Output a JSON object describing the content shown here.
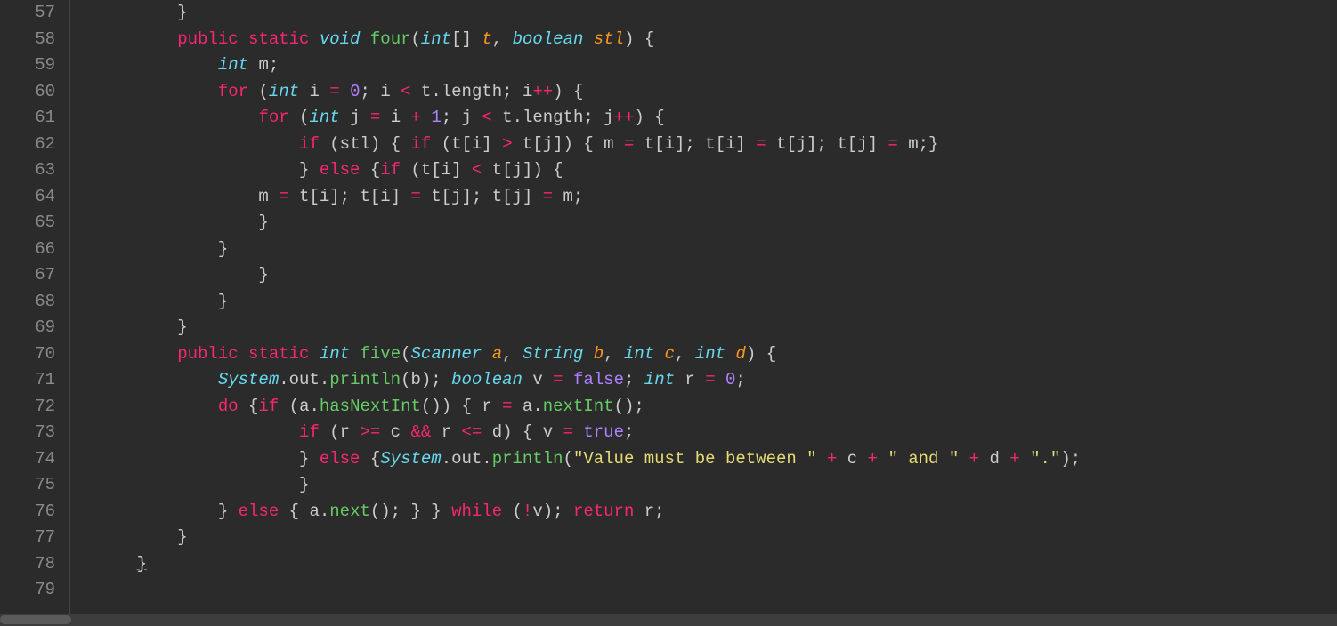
{
  "gutter": {
    "start": 57,
    "end": 79
  },
  "code": {
    "lines": [
      [
        [
          "        }",
          "punct"
        ]
      ],
      [
        [
          "        ",
          "punct"
        ],
        [
          "public",
          "kw"
        ],
        [
          " ",
          "punct"
        ],
        [
          "static",
          "kw"
        ],
        [
          " ",
          "punct"
        ],
        [
          "void",
          "type"
        ],
        [
          " ",
          "punct"
        ],
        [
          "four",
          "fn"
        ],
        [
          "(",
          "punct"
        ],
        [
          "int",
          "type"
        ],
        [
          "[] ",
          "punct"
        ],
        [
          "t",
          "param"
        ],
        [
          ", ",
          "punct"
        ],
        [
          "boolean",
          "type"
        ],
        [
          " ",
          "punct"
        ],
        [
          "stl",
          "param"
        ],
        [
          ") {",
          "punct"
        ]
      ],
      [
        [
          "            ",
          "punct"
        ],
        [
          "int",
          "type"
        ],
        [
          " m;",
          "punct"
        ]
      ],
      [
        [
          "            ",
          "punct"
        ],
        [
          "for",
          "kw"
        ],
        [
          " (",
          "punct"
        ],
        [
          "int",
          "type"
        ],
        [
          " i ",
          "punct"
        ],
        [
          "=",
          "op"
        ],
        [
          " ",
          "punct"
        ],
        [
          "0",
          "num"
        ],
        [
          "; i ",
          "punct"
        ],
        [
          "<",
          "op"
        ],
        [
          " t.length; i",
          "punct"
        ],
        [
          "++",
          "op"
        ],
        [
          ") {",
          "punct"
        ]
      ],
      [
        [
          "                ",
          "punct"
        ],
        [
          "for",
          "kw"
        ],
        [
          " (",
          "punct"
        ],
        [
          "int",
          "type"
        ],
        [
          " j ",
          "punct"
        ],
        [
          "=",
          "op"
        ],
        [
          " i ",
          "punct"
        ],
        [
          "+",
          "op"
        ],
        [
          " ",
          "punct"
        ],
        [
          "1",
          "num"
        ],
        [
          "; j ",
          "punct"
        ],
        [
          "<",
          "op"
        ],
        [
          " t.length; j",
          "punct"
        ],
        [
          "++",
          "op"
        ],
        [
          ") {",
          "punct"
        ]
      ],
      [
        [
          "                    ",
          "punct"
        ],
        [
          "if",
          "kw"
        ],
        [
          " (stl) { ",
          "punct"
        ],
        [
          "if",
          "kw"
        ],
        [
          " (t[i] ",
          "punct"
        ],
        [
          ">",
          "op"
        ],
        [
          " t[j]) { m ",
          "punct"
        ],
        [
          "=",
          "op"
        ],
        [
          " t[i]; t[i] ",
          "punct"
        ],
        [
          "=",
          "op"
        ],
        [
          " t[j]; t[j] ",
          "punct"
        ],
        [
          "=",
          "op"
        ],
        [
          " m;}",
          "punct"
        ]
      ],
      [
        [
          "                    } ",
          "punct"
        ],
        [
          "else",
          "kw"
        ],
        [
          " {",
          "punct"
        ],
        [
          "if",
          "kw"
        ],
        [
          " (t[i] ",
          "punct"
        ],
        [
          "<",
          "op"
        ],
        [
          " t[j]) {",
          "punct"
        ]
      ],
      [
        [
          "                m ",
          "punct"
        ],
        [
          "=",
          "op"
        ],
        [
          " t[i]; t[i] ",
          "punct"
        ],
        [
          "=",
          "op"
        ],
        [
          " t[j]; t[j] ",
          "punct"
        ],
        [
          "=",
          "op"
        ],
        [
          " m;",
          "punct"
        ]
      ],
      [
        [
          "                }",
          "punct"
        ]
      ],
      [
        [
          "            }",
          "punct"
        ]
      ],
      [
        [
          "                }",
          "punct"
        ]
      ],
      [
        [
          "            }",
          "punct"
        ]
      ],
      [
        [
          "        }",
          "punct"
        ]
      ],
      [
        [
          "        ",
          "punct"
        ],
        [
          "public",
          "kw"
        ],
        [
          " ",
          "punct"
        ],
        [
          "static",
          "kw"
        ],
        [
          " ",
          "punct"
        ],
        [
          "int",
          "type"
        ],
        [
          " ",
          "punct"
        ],
        [
          "five",
          "fn"
        ],
        [
          "(",
          "punct"
        ],
        [
          "Scanner",
          "type"
        ],
        [
          " ",
          "punct"
        ],
        [
          "a",
          "param"
        ],
        [
          ", ",
          "punct"
        ],
        [
          "String",
          "type"
        ],
        [
          " ",
          "punct"
        ],
        [
          "b",
          "param"
        ],
        [
          ", ",
          "punct"
        ],
        [
          "int",
          "type"
        ],
        [
          " ",
          "punct"
        ],
        [
          "c",
          "param"
        ],
        [
          ", ",
          "punct"
        ],
        [
          "int",
          "type"
        ],
        [
          " ",
          "punct"
        ],
        [
          "d",
          "param"
        ],
        [
          ") {",
          "punct"
        ]
      ],
      [
        [
          "            ",
          "punct"
        ],
        [
          "System",
          "type"
        ],
        [
          ".out.",
          "punct"
        ],
        [
          "println",
          "fn"
        ],
        [
          "(b); ",
          "punct"
        ],
        [
          "boolean",
          "type"
        ],
        [
          " v ",
          "punct"
        ],
        [
          "=",
          "op"
        ],
        [
          " ",
          "punct"
        ],
        [
          "false",
          "const"
        ],
        [
          "; ",
          "punct"
        ],
        [
          "int",
          "type"
        ],
        [
          " r ",
          "punct"
        ],
        [
          "=",
          "op"
        ],
        [
          " ",
          "punct"
        ],
        [
          "0",
          "num"
        ],
        [
          ";",
          "punct"
        ]
      ],
      [
        [
          "            ",
          "punct"
        ],
        [
          "do",
          "kw"
        ],
        [
          " {",
          "punct"
        ],
        [
          "if",
          "kw"
        ],
        [
          " (a.",
          "punct"
        ],
        [
          "hasNextInt",
          "fn"
        ],
        [
          "()) { r ",
          "punct"
        ],
        [
          "=",
          "op"
        ],
        [
          " a.",
          "punct"
        ],
        [
          "nextInt",
          "fn"
        ],
        [
          "();",
          "punct"
        ]
      ],
      [
        [
          "                    ",
          "punct"
        ],
        [
          "if",
          "kw"
        ],
        [
          " (r ",
          "punct"
        ],
        [
          ">=",
          "op"
        ],
        [
          " c ",
          "punct"
        ],
        [
          "&&",
          "op"
        ],
        [
          " r ",
          "punct"
        ],
        [
          "<=",
          "op"
        ],
        [
          " d) { v ",
          "punct"
        ],
        [
          "=",
          "op"
        ],
        [
          " ",
          "punct"
        ],
        [
          "true",
          "const"
        ],
        [
          ";",
          "punct"
        ]
      ],
      [
        [
          "                    } ",
          "punct"
        ],
        [
          "else",
          "kw"
        ],
        [
          " {",
          "punct"
        ],
        [
          "System",
          "type"
        ],
        [
          ".out.",
          "punct"
        ],
        [
          "println",
          "fn"
        ],
        [
          "(",
          "punct"
        ],
        [
          "\"Value must be between \"",
          "str"
        ],
        [
          " ",
          "punct"
        ],
        [
          "+",
          "op"
        ],
        [
          " c ",
          "punct"
        ],
        [
          "+",
          "op"
        ],
        [
          " ",
          "punct"
        ],
        [
          "\" and \"",
          "str"
        ],
        [
          " ",
          "punct"
        ],
        [
          "+",
          "op"
        ],
        [
          " d ",
          "punct"
        ],
        [
          "+",
          "op"
        ],
        [
          " ",
          "punct"
        ],
        [
          "\".\"",
          "str"
        ],
        [
          ");",
          "punct"
        ]
      ],
      [
        [
          "                    }",
          "punct"
        ]
      ],
      [
        [
          "            } ",
          "punct"
        ],
        [
          "else",
          "kw"
        ],
        [
          " { a.",
          "punct"
        ],
        [
          "next",
          "fn"
        ],
        [
          "(); } } ",
          "punct"
        ],
        [
          "while",
          "kw"
        ],
        [
          " (",
          "punct"
        ],
        [
          "!",
          "op"
        ],
        [
          "v); ",
          "punct"
        ],
        [
          "return",
          "kw"
        ],
        [
          " r;",
          "punct"
        ]
      ],
      [
        [
          "        }",
          "punct"
        ]
      ],
      [
        [
          "    ",
          "punct"
        ],
        [
          "}",
          "underline"
        ]
      ],
      [
        [
          "",
          "punct"
        ]
      ]
    ]
  }
}
